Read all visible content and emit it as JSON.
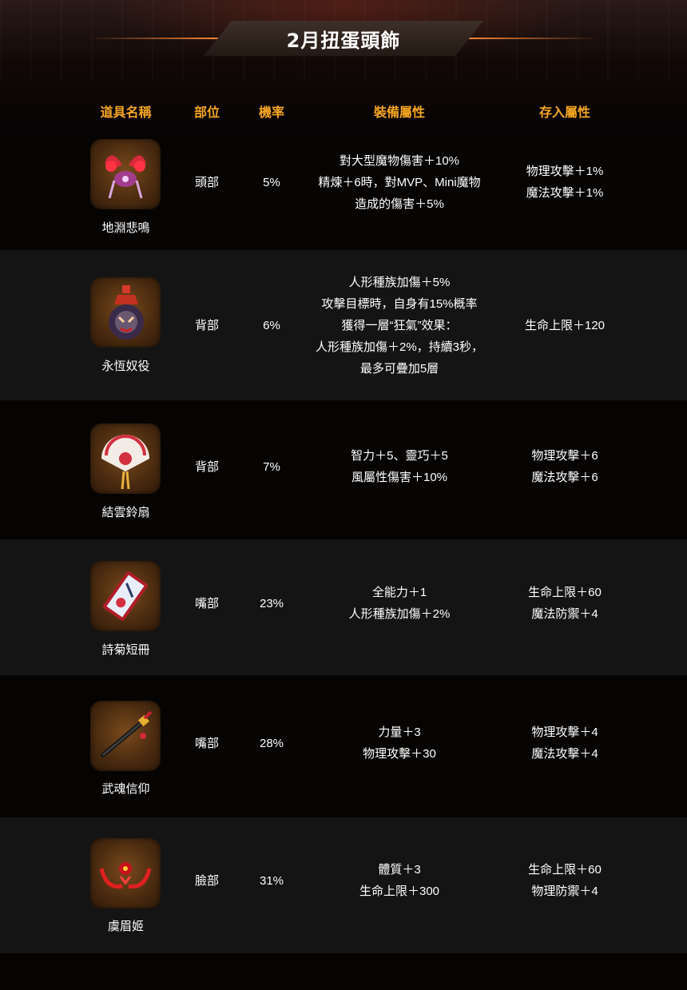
{
  "page": {
    "title": "2月扭蛋頭飾"
  },
  "headers": {
    "name": "道具名稱",
    "part": "部位",
    "rate": "機率",
    "attr": "裝備屬性",
    "store": "存入屬性"
  },
  "colors": {
    "accent": "#f5a623",
    "row_alt": "#141414",
    "background": "#060403"
  },
  "items": [
    {
      "name": "地淵悲鳴",
      "icon": "abyss-wail-icon",
      "part": "頭部",
      "rate": "5%",
      "attr": [
        "對大型魔物傷害＋10%",
        "精煉＋6時，對MVP、Mini魔物",
        "造成的傷害＋5%"
      ],
      "store": [
        "物理攻擊＋1%",
        "魔法攻擊＋1%"
      ]
    },
    {
      "name": "永恆奴役",
      "icon": "eternal-servitude-icon",
      "part": "背部",
      "rate": "6%",
      "attr": [
        "人形種族加傷＋5%",
        "攻擊目標時，自身有15%概率",
        "獲得一層“狂氣”效果：",
        "人形種族加傷＋2%，持續3秒，",
        "最多可疊加5層"
      ],
      "store": [
        "生命上限＋120"
      ]
    },
    {
      "name": "結雲鈴扇",
      "icon": "cloud-bell-fan-icon",
      "part": "背部",
      "rate": "7%",
      "attr": [
        "智力＋5、靈巧＋5",
        "風屬性傷害＋10%"
      ],
      "store": [
        "物理攻擊＋6",
        "魔法攻擊＋6"
      ]
    },
    {
      "name": "詩菊短冊",
      "icon": "poem-card-icon",
      "part": "嘴部",
      "rate": "23%",
      "attr": [
        "全能力＋1",
        "人形種族加傷＋2%"
      ],
      "store": [
        "生命上限＋60",
        "魔法防禦＋4"
      ]
    },
    {
      "name": "武魂信仰",
      "icon": "katana-icon",
      "part": "嘴部",
      "rate": "28%",
      "attr": [
        "力量＋3",
        "物理攻擊＋30"
      ],
      "store": [
        "物理攻擊＋4",
        "魔法攻擊＋4"
      ]
    },
    {
      "name": "虞眉姬",
      "icon": "red-horn-mask-icon",
      "part": "臉部",
      "rate": "31%",
      "attr": [
        "體質＋3",
        "生命上限＋300"
      ],
      "store": [
        "生命上限＋60",
        "物理防禦＋4"
      ]
    }
  ]
}
